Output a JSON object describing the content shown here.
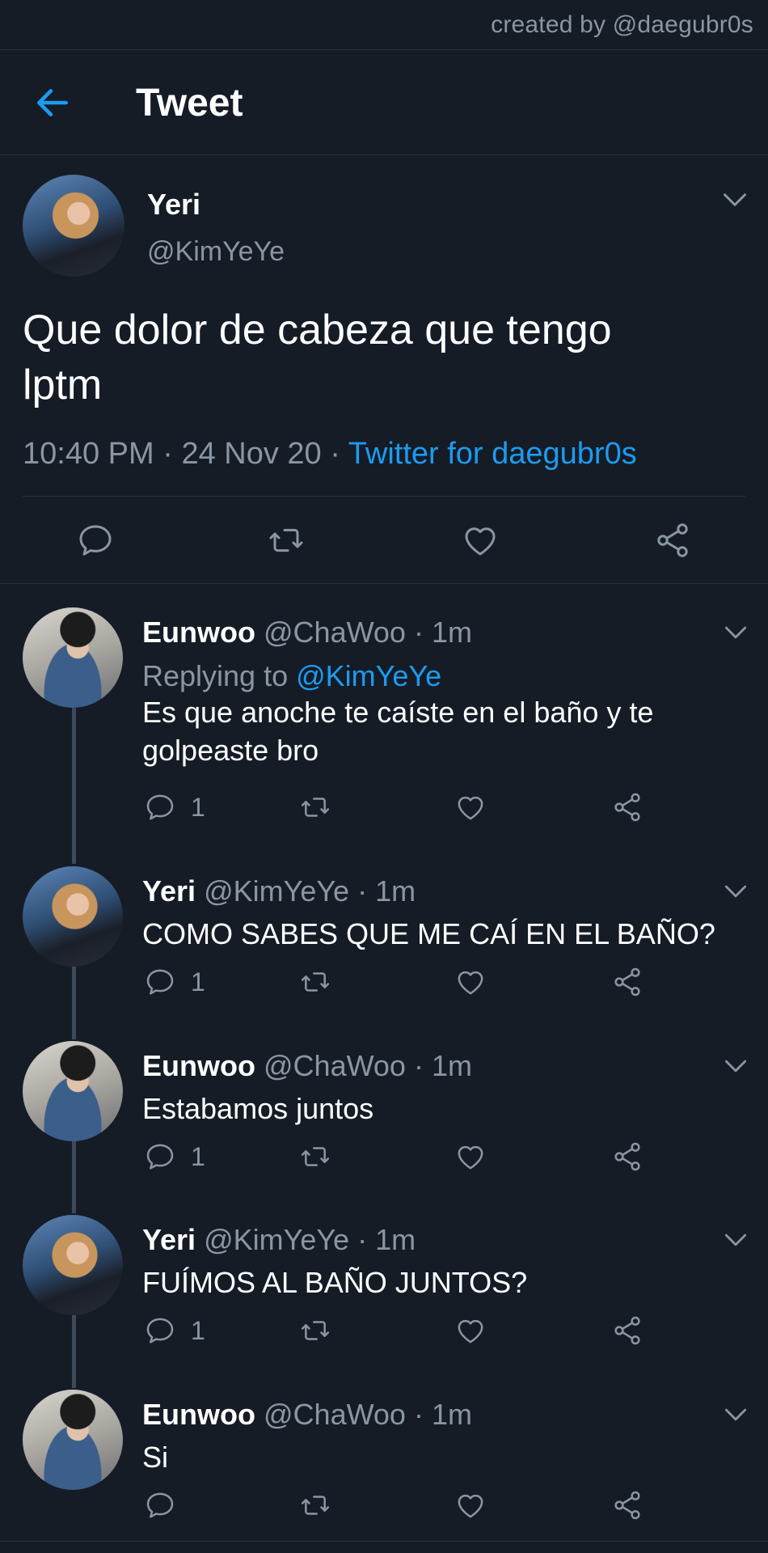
{
  "credit": "created by @daegubr0s",
  "header": {
    "title": "Tweet"
  },
  "main_tweet": {
    "name": "Yeri",
    "handle": "@KimYeYe",
    "text_line1": "Que dolor de cabeza que tengo",
    "text_line2": "lptm",
    "time": "10:40 PM",
    "date": "24 Nov 20",
    "client": "Twitter for daegubr0s",
    "sep": "·"
  },
  "replies": [
    {
      "name": "Eunwoo",
      "handle": "@ChaWoo · 1m",
      "replying_prefix": "Replying to ",
      "replying_to": "@KimYeYe",
      "text_line1": "Es que anoche te caíste en el baño y te",
      "text_line2": "golpeaste bro",
      "reply_count": "1"
    },
    {
      "name": "Yeri",
      "handle": "@KimYeYe · 1m",
      "text_line1": "COMO SABES QUE ME CAÍ EN EL BAÑO?",
      "reply_count": "1"
    },
    {
      "name": "Eunwoo",
      "handle": "@ChaWoo · 1m",
      "text_line1": "Estabamos juntos",
      "reply_count": "1"
    },
    {
      "name": "Yeri",
      "handle": "@KimYeYe · 1m",
      "text_line1": "FUÍMOS AL BAÑO JUNTOS?",
      "reply_count": "1"
    },
    {
      "name": "Eunwoo",
      "handle": "@ChaWoo · 1m",
      "text_line1": "Si",
      "reply_count": ""
    }
  ],
  "colors": {
    "background": "#151c26",
    "accent": "#1d9bf0",
    "muted": "#8a96a3",
    "thread_line": "#3d4a5c"
  },
  "icons": [
    "back-arrow-icon",
    "chevron-down-icon",
    "reply-icon",
    "retweet-icon",
    "like-icon",
    "share-icon"
  ]
}
